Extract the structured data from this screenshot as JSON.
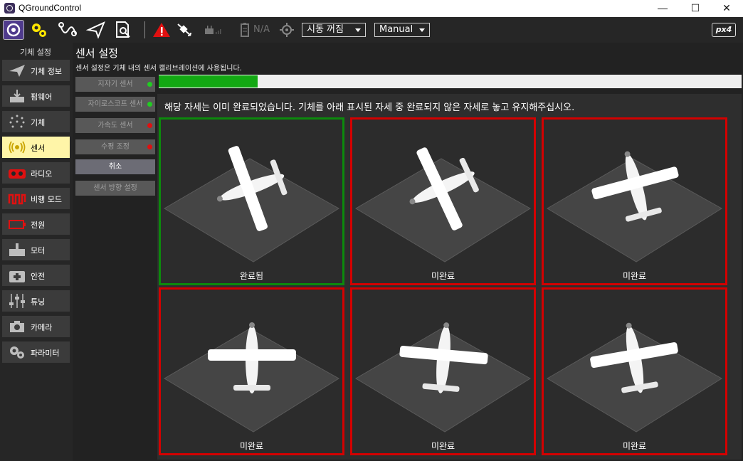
{
  "window": {
    "title": "QGroundControl",
    "minimize": "—",
    "maximize": "☐",
    "close": "✕"
  },
  "toolbar": {
    "battery_text": "N/A",
    "arm_mode": "시동 꺼짐",
    "flight_mode": "Manual",
    "brand_logo": "px4"
  },
  "sidebar": {
    "header": "기체 설정",
    "items": [
      {
        "label": "기체 정보",
        "icon": "plane-icon"
      },
      {
        "label": "펌웨어",
        "icon": "download-icon"
      },
      {
        "label": "기체",
        "icon": "airframe-icon"
      },
      {
        "label": "센서",
        "icon": "sensor-icon",
        "active": true
      },
      {
        "label": "라디오",
        "icon": "radio-icon"
      },
      {
        "label": "비행 모드",
        "icon": "flight-mode-icon"
      },
      {
        "label": "전원",
        "icon": "battery-icon"
      },
      {
        "label": "모터",
        "icon": "motor-icon"
      },
      {
        "label": "안전",
        "icon": "safety-icon"
      },
      {
        "label": "튜닝",
        "icon": "tuning-icon"
      },
      {
        "label": "카메라",
        "icon": "camera-icon"
      },
      {
        "label": "파라미터",
        "icon": "gears-icon"
      }
    ]
  },
  "page": {
    "title": "센서 설정",
    "description": "센서 설정은 기체 내의 센서 캘리브레이션에 사용됩니다."
  },
  "sensor_buttons": [
    {
      "label": "지자기 센서",
      "status": "ok",
      "status_color": "#22cc22"
    },
    {
      "label": "자이로스코프 센서",
      "status": "ok",
      "status_color": "#22cc22"
    },
    {
      "label": "가속도 센서",
      "status": "not_done",
      "status_color": "#e01010"
    },
    {
      "label": "수평 조정",
      "status": "not_done",
      "status_color": "#e01010"
    }
  ],
  "cancel_label": "취소",
  "orientation_label": "센서 방향 설정",
  "calibration": {
    "progress": 0.17,
    "instruction": "해당 자세는 이미 완료되었습니다. 기체를 아래 표시된 자세 중 완료되지 않은 자세로 놓고 유지해주십시오.",
    "tiles": [
      {
        "status": "완료됨",
        "done": true
      },
      {
        "status": "미완료",
        "done": false
      },
      {
        "status": "미완료",
        "done": false
      },
      {
        "status": "미완료",
        "done": false
      },
      {
        "status": "미완료",
        "done": false
      },
      {
        "status": "미완료",
        "done": false
      }
    ]
  },
  "colors": {
    "accent_purple": "#4f3b8c",
    "active_item": "#fff5a8",
    "done_border": "#0c8a0c",
    "pending_border": "#d40000",
    "progress_fill": "#13a813",
    "warning": "#e01010"
  }
}
